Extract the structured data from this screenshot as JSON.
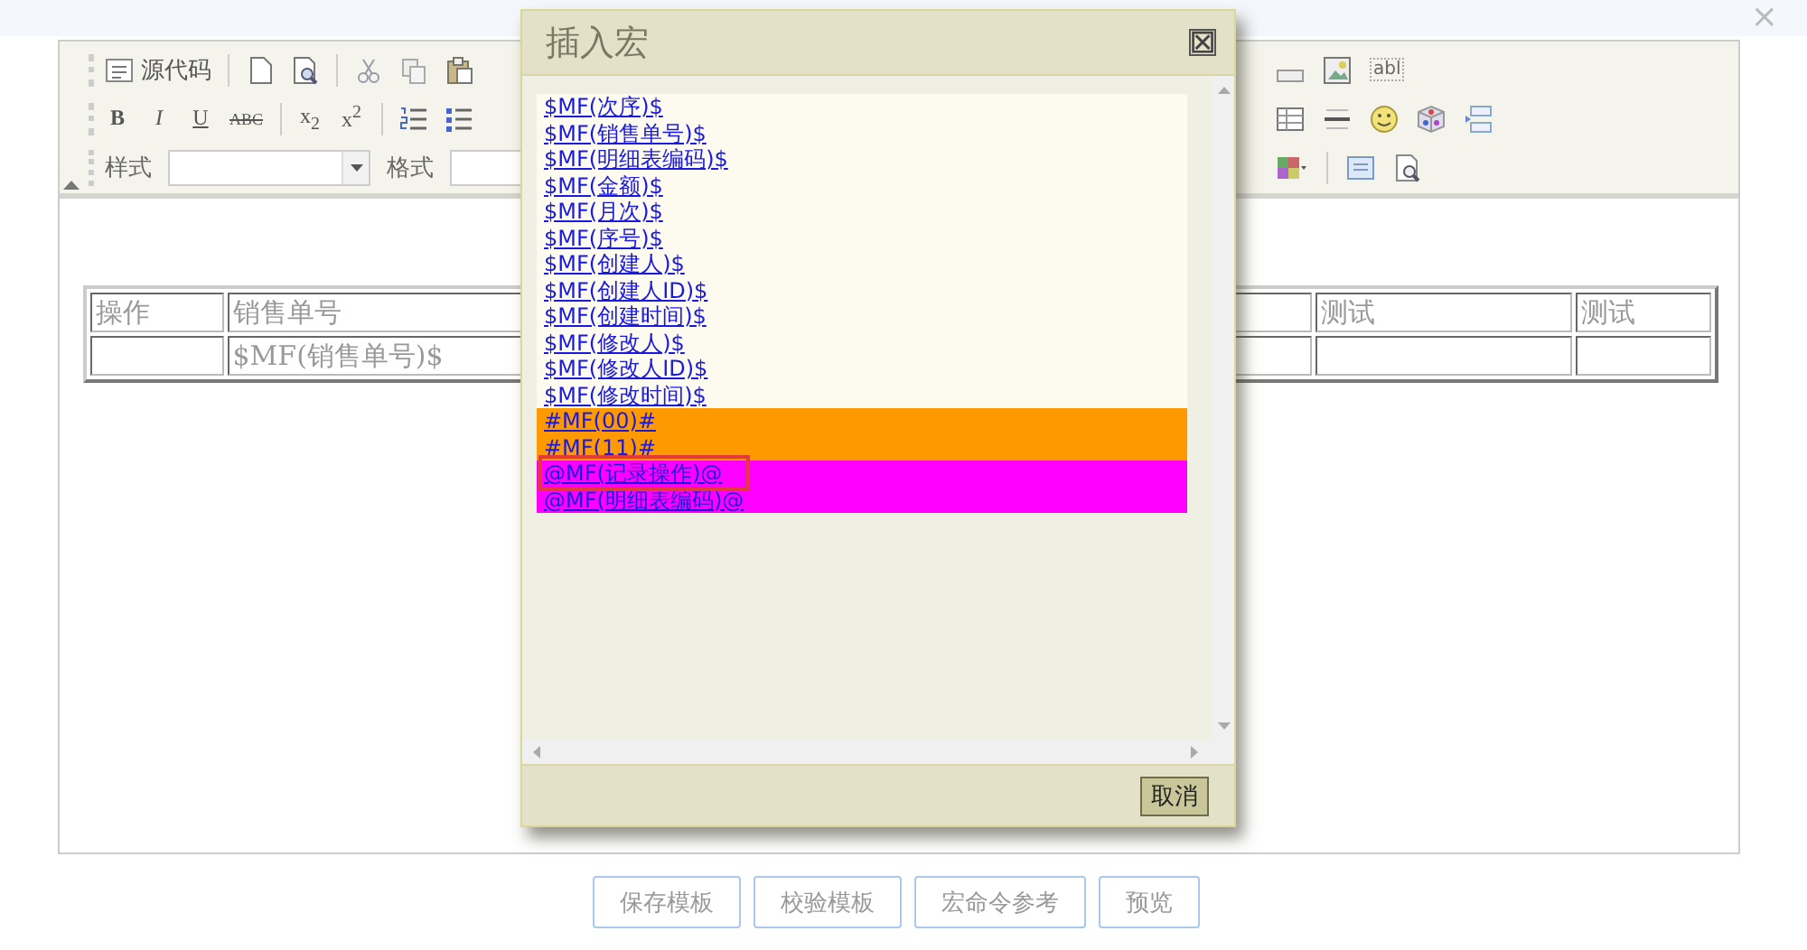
{
  "window": {
    "close_label": "×"
  },
  "toolbar": {
    "source_button": "源代码",
    "text_field_icon": "abl",
    "format_buttons": [
      "B",
      "I",
      "U",
      "ABC",
      "x$_{2}$",
      "x$^{2}$"
    ],
    "field_labels": [
      "样式",
      "格式"
    ]
  },
  "table": {
    "columns": [
      "操作",
      "销售单号",
      "测试",
      "测试"
    ],
    "row": {
      "column_2": "$MF(销售单号)$"
    }
  },
  "dialog": {
    "title": "插入宏",
    "close_label": "⊠",
    "macros": [
      {
        "text": "$MF(次序)$",
        "color": "#fdfaf0",
        "marked": false
      },
      {
        "text": "$MF(销售单号)$",
        "color": "#fdfaf0",
        "marked": false
      },
      {
        "text": "$MF(明细表编码)$",
        "color": "#fdfaf0",
        "marked": false
      },
      {
        "text": "$MF(金额)$",
        "color": "#fdfaf0",
        "marked": false
      },
      {
        "text": "$MF(月次)$",
        "color": "#fdfaf0",
        "marked": false
      },
      {
        "text": "$MF(序号)$",
        "color": "#fdfaf0",
        "marked": false
      },
      {
        "text": "$MF(创建人)$",
        "color": "#fdfaf0",
        "marked": false
      },
      {
        "text": "$MF(创建人ID)$",
        "color": "#fdfaf0",
        "marked": false
      },
      {
        "text": "$MF(创建时间)$",
        "color": "#fdfaf0",
        "marked": false
      },
      {
        "text": "$MF(修改人)$",
        "color": "#fdfaf0",
        "marked": false
      },
      {
        "text": "$MF(修改人ID)$",
        "color": "#fdfaf0",
        "marked": false
      },
      {
        "text": "$MF(修改时间)$",
        "color": "#fdfaf0",
        "marked": false
      },
      {
        "text": "#MF(00)#",
        "color": "#ff9900",
        "marked": false
      },
      {
        "text": "#MF(11)#",
        "color": "#ff9900",
        "marked": false
      },
      {
        "text": "@MF(记录操作)@",
        "color": "#ff00ff",
        "marked": true
      },
      {
        "text": "@MF(明细表编码)@",
        "color": "#ff00ff",
        "marked": false
      }
    ],
    "cancel": "取消"
  },
  "actions": [
    "保存模板",
    "校验模板",
    "宏命令参考",
    "预览"
  ]
}
